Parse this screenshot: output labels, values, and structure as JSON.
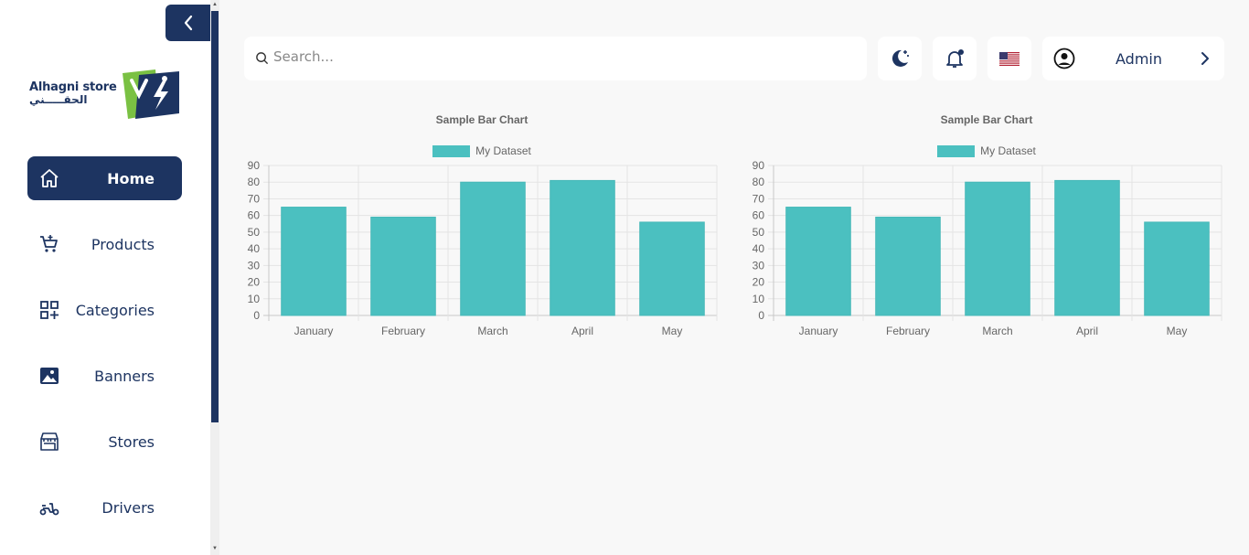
{
  "sidebar": {
    "logo": {
      "text": "Alhagni store",
      "arabic": "الحقـــــني"
    },
    "items": [
      {
        "label": "Home",
        "icon": "home-icon",
        "active": true
      },
      {
        "label": "Products",
        "icon": "cart-icon",
        "active": false
      },
      {
        "label": "Categories",
        "icon": "categories-icon",
        "active": false
      },
      {
        "label": "Banners",
        "icon": "image-icon",
        "active": false
      },
      {
        "label": "Stores",
        "icon": "store-icon",
        "active": false
      },
      {
        "label": "Drivers",
        "icon": "scooter-icon",
        "active": false
      }
    ]
  },
  "header": {
    "search": {
      "placeholder": "Search...",
      "value": ""
    },
    "theme_icon": "moon-stars-icon",
    "notification_icon": "bell-icon",
    "language_icon": "us-flag-icon",
    "user": {
      "name": "Admin",
      "icon": "user-circle-icon"
    }
  },
  "colors": {
    "primary": "#1d3461",
    "bar": "#4bc0c0",
    "background": "#f8f8f8"
  },
  "chart_data": [
    {
      "type": "bar",
      "title": "Sample Bar Chart",
      "categories": [
        "January",
        "February",
        "March",
        "April",
        "May"
      ],
      "series": [
        {
          "name": "My Dataset",
          "values": [
            65,
            59,
            80,
            81,
            56
          ]
        }
      ],
      "ylim": [
        0,
        90
      ],
      "yticks": [
        0,
        10,
        20,
        30,
        40,
        50,
        60,
        70,
        80,
        90
      ],
      "grid": true,
      "legend": "top"
    },
    {
      "type": "bar",
      "title": "Sample Bar Chart",
      "categories": [
        "January",
        "February",
        "March",
        "April",
        "May"
      ],
      "series": [
        {
          "name": "My Dataset",
          "values": [
            65,
            59,
            80,
            81,
            56
          ]
        }
      ],
      "ylim": [
        0,
        90
      ],
      "yticks": [
        0,
        10,
        20,
        30,
        40,
        50,
        60,
        70,
        80,
        90
      ],
      "grid": true,
      "legend": "top"
    }
  ]
}
